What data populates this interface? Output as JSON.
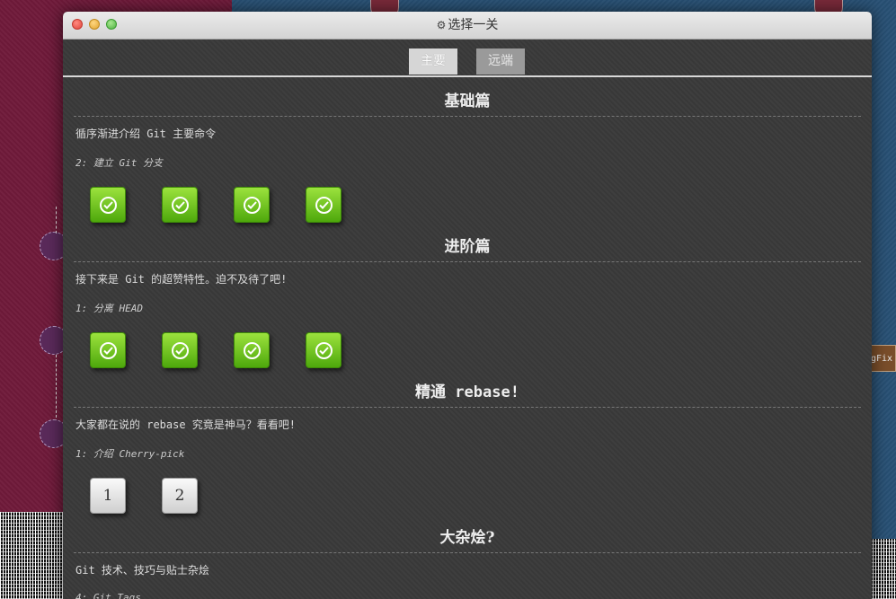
{
  "window": {
    "title": "选择一关",
    "title_icon": "gear-icon"
  },
  "tabs": [
    {
      "label": "主要",
      "active": true
    },
    {
      "label": "远端",
      "active": false
    }
  ],
  "sections": [
    {
      "title": "基础篇",
      "desc": "循序渐进介绍 Git 主要命令",
      "current_level": "2: 建立 Git 分支",
      "levels": [
        "done",
        "done",
        "done",
        "done"
      ]
    },
    {
      "title": "进阶篇",
      "desc": "接下来是 Git 的超赞特性。迫不及待了吧!",
      "current_level": "1: 分离 HEAD",
      "levels": [
        "done",
        "done",
        "done",
        "done"
      ]
    },
    {
      "title": "精通 rebase!",
      "desc": "大家都在说的 rebase 究竟是神马？看看吧!",
      "current_level": "1: 介绍 Cherry-pick",
      "levels": [
        "1",
        "2"
      ]
    },
    {
      "title": "大杂烩?",
      "desc": "Git 技术、技巧与贴士杂烩",
      "current_level": "4: Git Tags"
    }
  ],
  "colors": {
    "done": "#6cc21a",
    "todo": "#e8e8e8",
    "window_bg": "#3a3a3a"
  },
  "background": {
    "tag_text": "gFix"
  }
}
